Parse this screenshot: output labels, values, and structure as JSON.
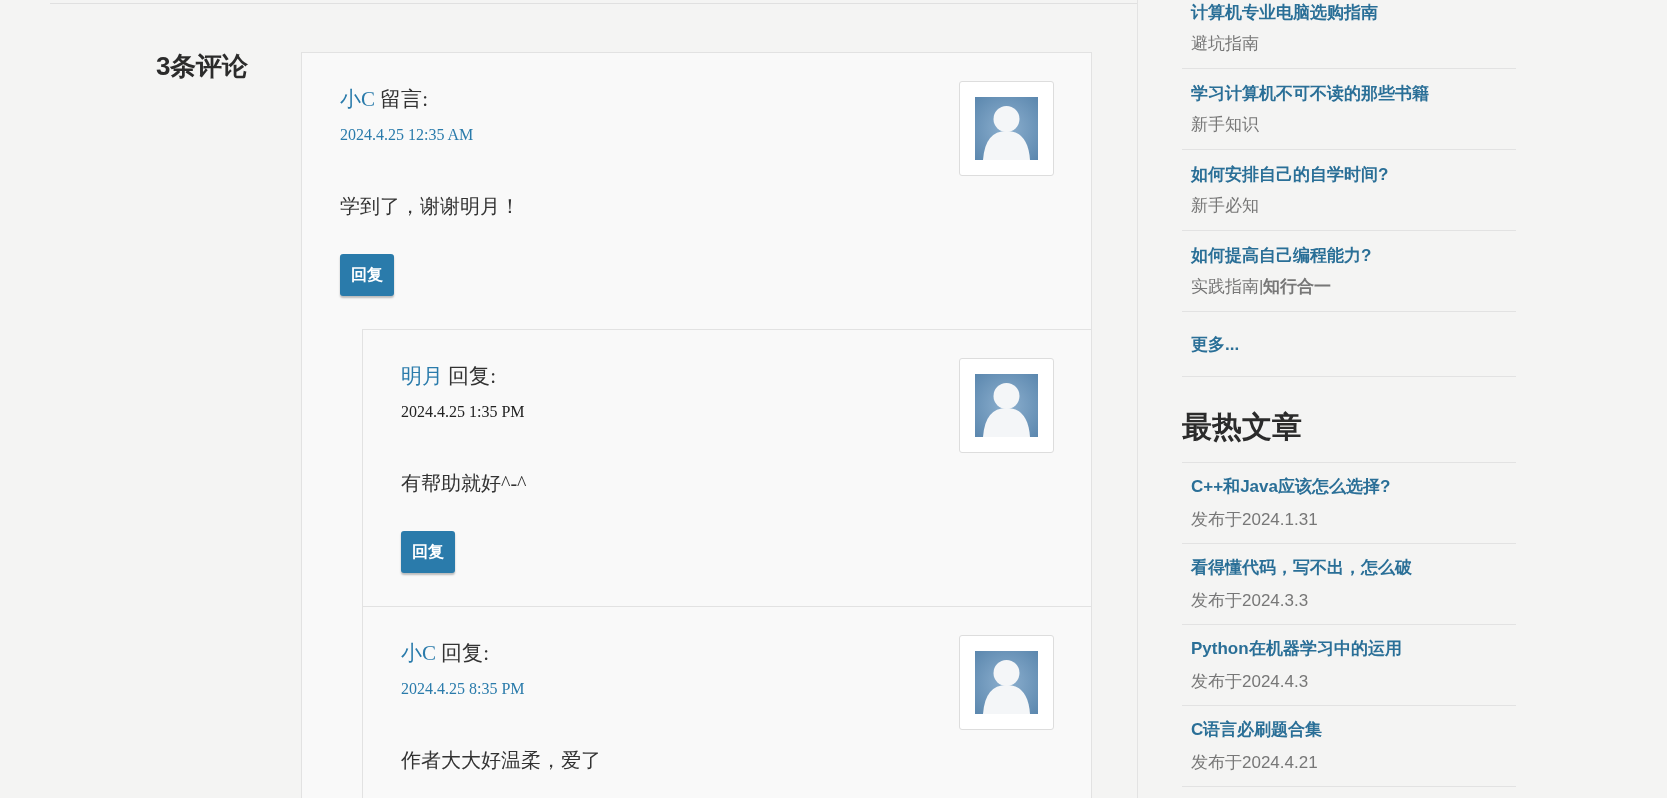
{
  "comments_section": {
    "heading": "3条评论",
    "comments": [
      {
        "author": "小C",
        "action": "留言:",
        "date": "2024.4.25 12:35 AM",
        "date_linked": true,
        "text": "学到了，谢谢明月！",
        "reply_button": "回复",
        "children": [
          {
            "author": "明月",
            "action": "回复:",
            "date": "2024.4.25 1:35 PM",
            "date_linked": false,
            "text": "有帮助就好^-^",
            "reply_button": "回复"
          },
          {
            "author": "小C",
            "action": "回复:",
            "date": "2024.4.25 8:35 PM",
            "date_linked": true,
            "text": "作者大大好温柔，爱了"
          }
        ]
      }
    ]
  },
  "sidebar": {
    "top_list": [
      {
        "title": "计算机专业电脑选购指南",
        "subtitle": "避坑指南"
      },
      {
        "title": "学习计算机不可不读的那些书籍",
        "subtitle": "新手知识"
      },
      {
        "title": "如何安排自己的自学时间?",
        "subtitle": "新手必知"
      },
      {
        "title": "如何提高自己编程能力?",
        "subtitle": "实践指南|**知行合一**"
      },
      {
        "title": "更多..."
      }
    ],
    "hot_heading": "最热文章",
    "hot_list": [
      {
        "title": "C++和Java应该怎么选择?",
        "subtitle": "发布于2024.1.31"
      },
      {
        "title": "看得懂代码，写不出，怎么破",
        "subtitle": "发布于2024.3.3"
      },
      {
        "title": "Python在机器学习中的运用",
        "subtitle": "发布于2024.4.3"
      },
      {
        "title": "C语言必刷题合集",
        "subtitle": "发布于2024.4.21"
      }
    ]
  }
}
